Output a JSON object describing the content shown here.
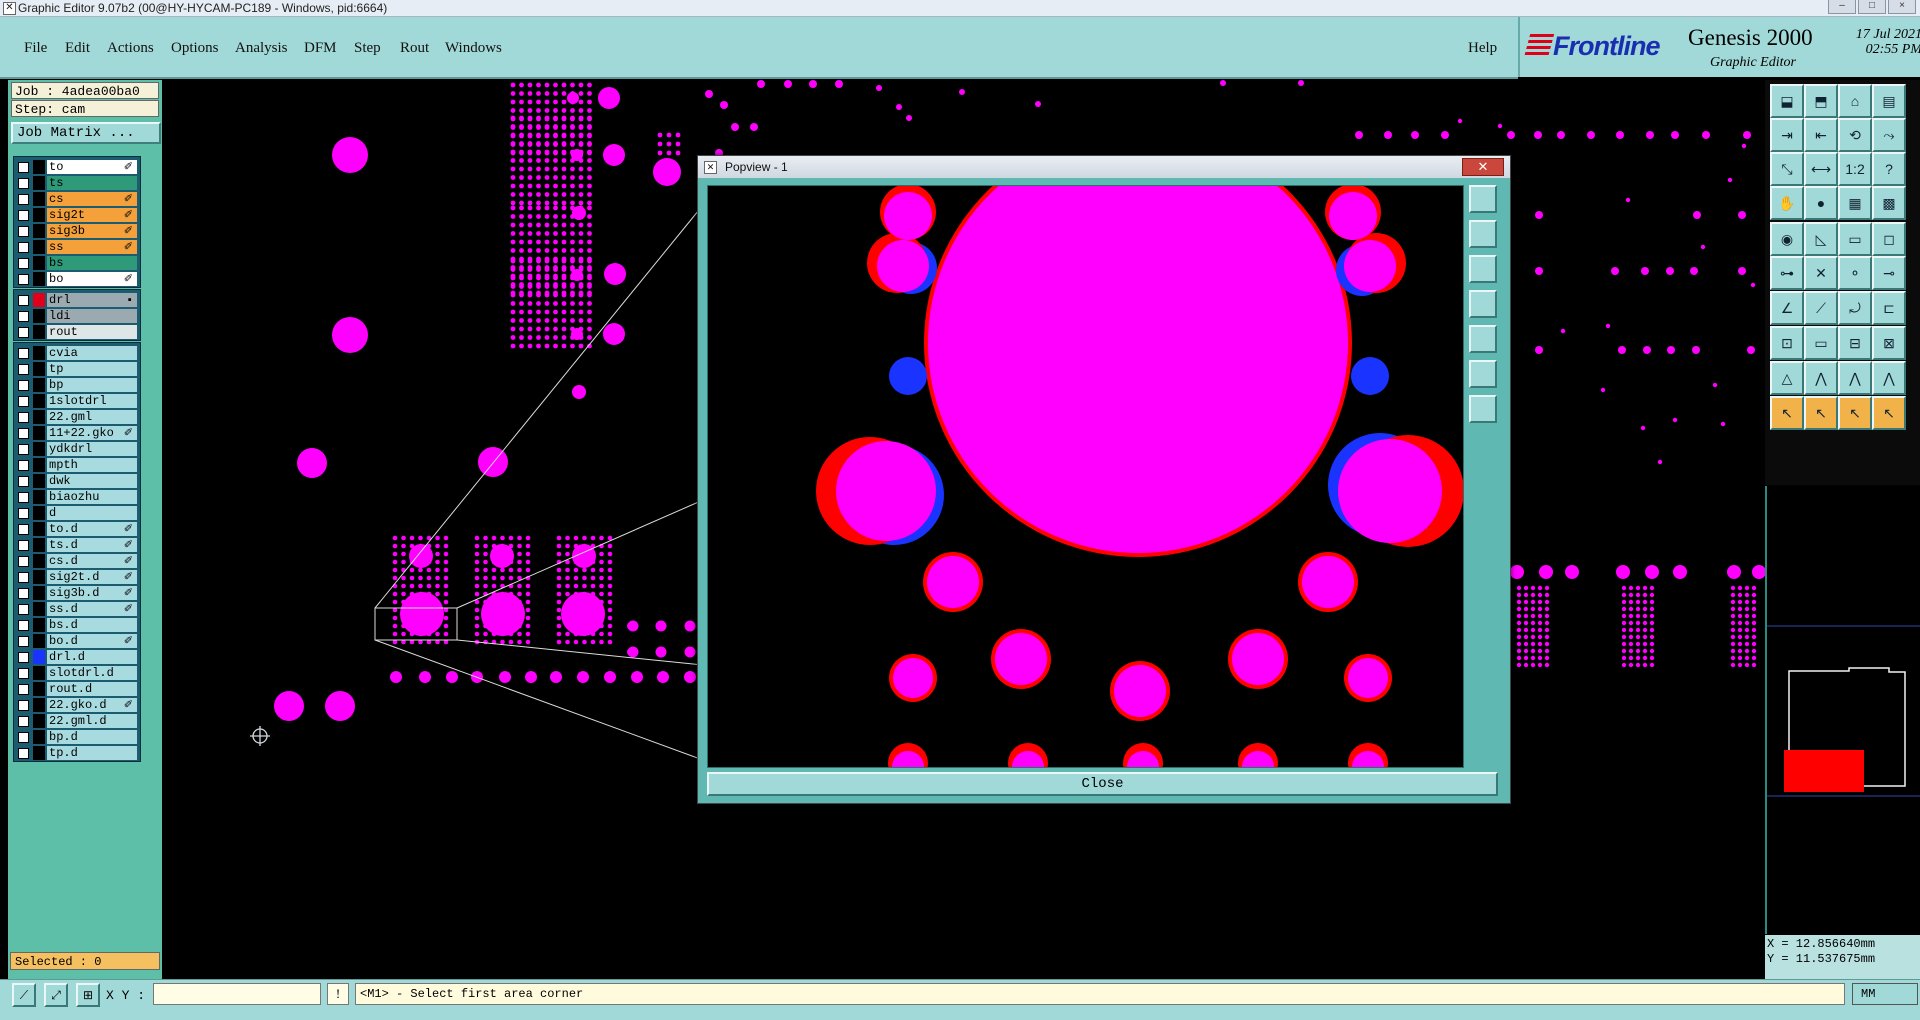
{
  "window": {
    "title": "Graphic Editor 9.07b2 (00@HY-HYCAM-PC189 - Windows, pid:6664)",
    "controls": [
      "–",
      "□",
      "×"
    ]
  },
  "menu": {
    "items": [
      "File",
      "Edit",
      "Actions",
      "Options",
      "Analysis",
      "DFM",
      "Step",
      "Rout",
      "Windows"
    ],
    "help": "Help"
  },
  "brand": {
    "logo": "Frontline",
    "product": "Genesis 2000",
    "subtitle": "Graphic Editor",
    "date": "17 Jul 2021",
    "time": "02:55 PM"
  },
  "left": {
    "job": "Job : 4adea00ba0",
    "step": "Step: cam",
    "job_matrix": "Job Matrix ...",
    "board_layers": [
      {
        "name": "to",
        "color": "#ffffff",
        "mark": "✐"
      },
      {
        "name": "ts",
        "color": "#2e9a7a",
        "mark": ""
      },
      {
        "name": "cs",
        "color": "#f4a13c",
        "mark": "✐"
      },
      {
        "name": "sig2t",
        "color": "#f4a13c",
        "mark": "✐"
      },
      {
        "name": "sig3b",
        "color": "#f4a13c",
        "mark": "✐"
      },
      {
        "name": "ss",
        "color": "#f4a13c",
        "mark": "✐"
      },
      {
        "name": "bs",
        "color": "#2e9a7a",
        "mark": ""
      },
      {
        "name": "bo",
        "color": "#ffffff",
        "mark": "✐"
      }
    ],
    "drill_layers": [
      {
        "name": "drl",
        "color": "#9aaab0",
        "mark": "▪",
        "swatch": "#e0001a"
      },
      {
        "name": "ldi",
        "color": "#9aaab0",
        "mark": ""
      },
      {
        "name": "rout",
        "color": "#dfe6e8",
        "mark": ""
      }
    ],
    "misc_layers": [
      {
        "name": "cvia",
        "mark": ""
      },
      {
        "name": "tp",
        "mark": ""
      },
      {
        "name": "bp",
        "mark": ""
      },
      {
        "name": "1slotdrl",
        "mark": ""
      },
      {
        "name": "22.gml",
        "mark": ""
      },
      {
        "name": "11+22.gko",
        "mark": "✐"
      },
      {
        "name": "ydkdrl",
        "mark": ""
      },
      {
        "name": "mpth",
        "mark": ""
      },
      {
        "name": "dwk",
        "mark": ""
      },
      {
        "name": "biaozhu",
        "mark": ""
      },
      {
        "name": "d",
        "mark": ""
      },
      {
        "name": "to.d",
        "mark": "✐"
      },
      {
        "name": "ts.d",
        "mark": "✐"
      },
      {
        "name": "cs.d",
        "mark": "✐"
      },
      {
        "name": "sig2t.d",
        "mark": "✐"
      },
      {
        "name": "sig3b.d",
        "mark": "✐"
      },
      {
        "name": "ss.d",
        "mark": "✐"
      },
      {
        "name": "bs.d",
        "mark": ""
      },
      {
        "name": "bo.d",
        "mark": "✐"
      },
      {
        "name": "drl.d",
        "mark": "",
        "swatch": "#1a33ff"
      },
      {
        "name": "slotdrl.d",
        "mark": ""
      },
      {
        "name": "rout.d",
        "mark": ""
      },
      {
        "name": "22.gko.d",
        "mark": "✐"
      },
      {
        "name": "22.gml.d",
        "mark": ""
      },
      {
        "name": "bp.d",
        "mark": ""
      },
      {
        "name": "tp.d",
        "mark": ""
      }
    ],
    "selected": "Selected : 0"
  },
  "popview": {
    "title": "Popview - 1",
    "close_x": "✕",
    "close_button": "Close"
  },
  "coords": {
    "x": "X = 12.856640mm",
    "y": "Y = 11.537675mm"
  },
  "bottom": {
    "xy_label": "X Y :",
    "xy_value": "",
    "msg_icon": "!",
    "prompt": "<M1> - Select first area corner",
    "units": "MM"
  },
  "colors": {
    "pad": "#ff00ff",
    "outline": "#ff0000",
    "blue_layer": "#1a33ff",
    "panel": "#a1d9d8",
    "canvas": "#000000"
  }
}
